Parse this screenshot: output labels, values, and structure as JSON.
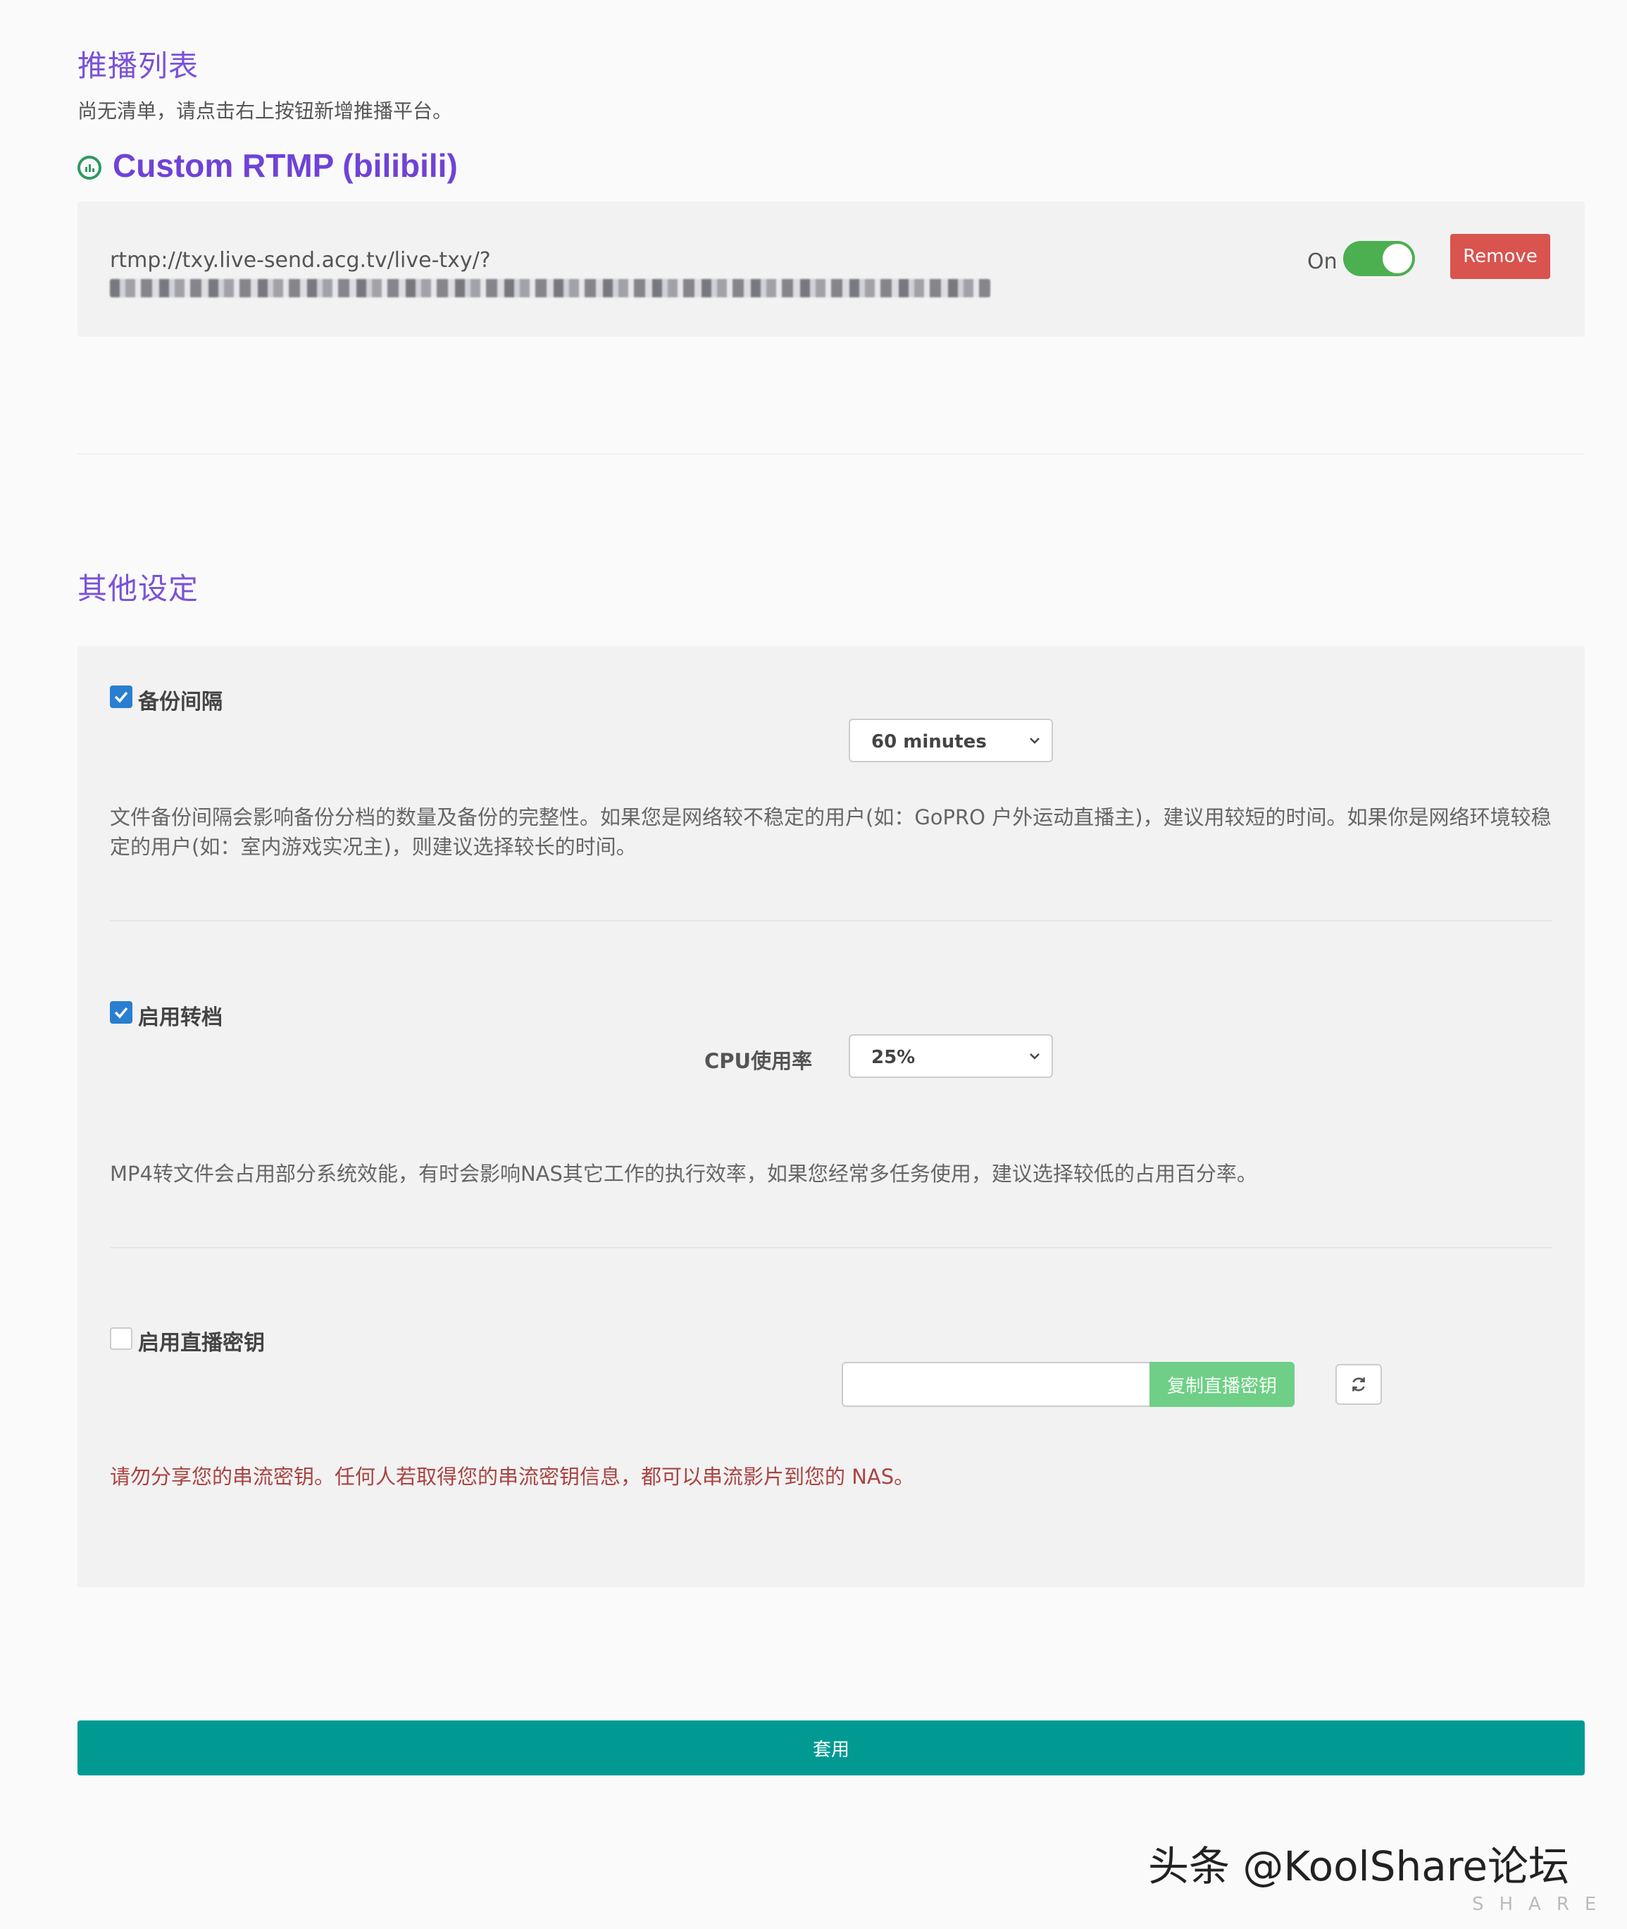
{
  "stream_list": {
    "title": "推播列表",
    "empty_hint": "尚无清单，请点击右上按钮新增推播平台。"
  },
  "platform": {
    "name": "Custom RTMP (bilibili)",
    "icon": "bilibili-icon",
    "url": "rtmp://txy.live-send.acg.tv/live-txy/?",
    "toggle_label": "On",
    "toggle_on": true,
    "remove_label": "Remove"
  },
  "other_settings": {
    "title": "其他设定",
    "backup": {
      "checked": true,
      "label": "备份间隔",
      "selected": "60 minutes",
      "description": "文件备份间隔会影响备份分档的数量及备份的完整性。如果您是网络较不稳定的用户(如：GoPRO 户外运动直播主)，建议用较短的时间。如果你是网络环境较稳定的用户(如：室内游戏实况主)，则建议选择较长的时间。"
    },
    "transcode": {
      "checked": true,
      "label": "启用转档",
      "cpu_label": "CPU使用率",
      "selected": "25%",
      "description": "MP4转文件会占用部分系统效能，有时会影响NAS其它工作的执行效率，如果您经常多任务使用，建议选择较低的占用百分率。"
    },
    "stream_key": {
      "checked": false,
      "label": "启用直播密钥",
      "value": "",
      "copy_label": "复制直播密钥",
      "refresh_icon": "refresh-icon",
      "warning": "请勿分享您的串流密钥。任何人若取得您的串流密钥信息，都可以串流影片到您的 NAS。"
    }
  },
  "apply_label": "套用",
  "watermark": {
    "text": "头条 @KoolShare论坛",
    "sub": "SHARE"
  },
  "colors": {
    "accent_purple": "#7a52d8",
    "toggle_green": "#4caf50",
    "remove_red": "#d9534f",
    "apply_teal": "#009a93",
    "copy_green": "#6fcf86",
    "warning_red": "#a94442"
  }
}
